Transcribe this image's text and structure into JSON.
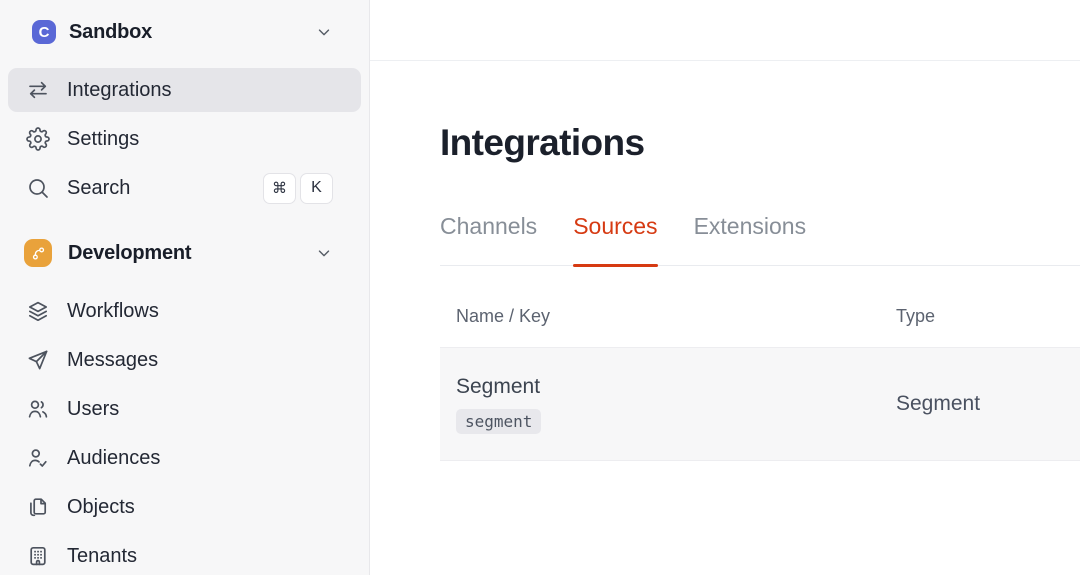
{
  "workspace": {
    "logo_letter": "C",
    "name": "Sandbox"
  },
  "sidebar": {
    "items": [
      {
        "label": "Integrations"
      },
      {
        "label": "Settings"
      },
      {
        "label": "Search"
      }
    ],
    "search_shortcut": {
      "cmd": "⌘",
      "k": "K"
    },
    "section": {
      "label": "Development"
    },
    "dev_items": [
      {
        "label": "Workflows"
      },
      {
        "label": "Messages"
      },
      {
        "label": "Users"
      },
      {
        "label": "Audiences"
      },
      {
        "label": "Objects"
      },
      {
        "label": "Tenants"
      }
    ]
  },
  "main": {
    "title": "Integrations",
    "tabs": [
      {
        "label": "Channels"
      },
      {
        "label": "Sources"
      },
      {
        "label": "Extensions"
      }
    ],
    "active_tab": "Sources",
    "table": {
      "columns": [
        "Name / Key",
        "Type"
      ],
      "rows": [
        {
          "name": "Segment",
          "key": "segment",
          "type": "Segment"
        }
      ]
    }
  },
  "colors": {
    "accent_red": "#d63a12",
    "workspace_logo_bg": "#5a68d6",
    "development_icon_bg": "#e9a23b",
    "sidebar_bg": "#f7f7f8",
    "active_item_bg": "#e5e5e9"
  }
}
